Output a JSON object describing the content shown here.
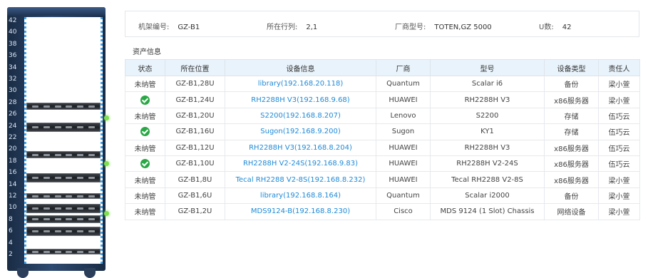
{
  "rack": {
    "unit_labels": [
      "42",
      "40",
      "38",
      "36",
      "34",
      "32",
      "30",
      "28",
      "26",
      "24",
      "22",
      "20",
      "18",
      "16",
      "14",
      "12",
      "10",
      "8",
      "6",
      "4",
      "2"
    ]
  },
  "info": {
    "rack_no_label": "机架编号:",
    "rack_no": "GZ-B1",
    "row_col_label": "所在行列:",
    "row_col": "2,1",
    "vendor_model_label": "厂商型号:",
    "vendor_model": "TOTEN,GZ 5000",
    "u_label": "U数:",
    "u_count": "42"
  },
  "section_title": "资产信息",
  "table": {
    "headers": [
      "状态",
      "所在位置",
      "设备信息",
      "厂商",
      "型号",
      "设备类型",
      "责任人"
    ],
    "rows": [
      {
        "status": "未纳管",
        "managed": false,
        "location": "GZ-B1,28U",
        "device": "library(192.168.20.118)",
        "vendor": "Quantum",
        "model": "Scalar i6",
        "type": "备份",
        "owner": "梁小萱"
      },
      {
        "status": "",
        "managed": true,
        "location": "GZ-B1,24U",
        "device": "RH2288H V3(192.168.9.68)",
        "vendor": "HUAWEI",
        "model": "RH2288H V3",
        "type": "x86服务器",
        "owner": "梁小萱"
      },
      {
        "status": "未纳管",
        "managed": false,
        "location": "GZ-B1,20U",
        "device": "S2200(192.168.8.207)",
        "vendor": "Lenovo",
        "model": "S2200",
        "type": "存储",
        "owner": "伍巧云"
      },
      {
        "status": "",
        "managed": true,
        "location": "GZ-B1,16U",
        "device": "Sugon(192.168.9.200)",
        "vendor": "Sugon",
        "model": "KY1",
        "type": "存储",
        "owner": "伍巧云"
      },
      {
        "status": "未纳管",
        "managed": false,
        "location": "GZ-B1,12U",
        "device": "RH2288H V3(192.168.8.204)",
        "vendor": "HUAWEI",
        "model": "RH2288H V3",
        "type": "x86服务器",
        "owner": "伍巧云"
      },
      {
        "status": "",
        "managed": true,
        "location": "GZ-B1,10U",
        "device": "RH2288H V2-24S(192.168.9.83)",
        "vendor": "HUAWEI",
        "model": "RH2288H V2-24S",
        "type": "x86服务器",
        "owner": "伍巧云"
      },
      {
        "status": "未纳管",
        "managed": false,
        "location": "GZ-B1,8U",
        "device": "Tecal RH2288 V2-8S(192.168.8.232)",
        "vendor": "HUAWEI",
        "model": "Tecal RH2288 V2-8S",
        "type": "x86服务器",
        "owner": "梁小萱"
      },
      {
        "status": "未纳管",
        "managed": false,
        "location": "GZ-B1,6U",
        "device": "library(192.168.8.164)",
        "vendor": "Quantum",
        "model": "Scalar i2000",
        "type": "备份",
        "owner": "梁小萱"
      },
      {
        "status": "未纳管",
        "managed": false,
        "location": "GZ-B1,2U",
        "device": "MDS9124-B(192.168.8.230)",
        "vendor": "Cisco",
        "model": "MDS 9124 (1 Slot) Chassis",
        "type": "网络设备",
        "owner": "梁小萱"
      }
    ]
  },
  "colors": {
    "link": "#1f8ad6",
    "managed_check": "#2aa846",
    "header_bg": "#e9f3fb",
    "rack_frame": "#1f3453",
    "led": "#7ee04f"
  }
}
